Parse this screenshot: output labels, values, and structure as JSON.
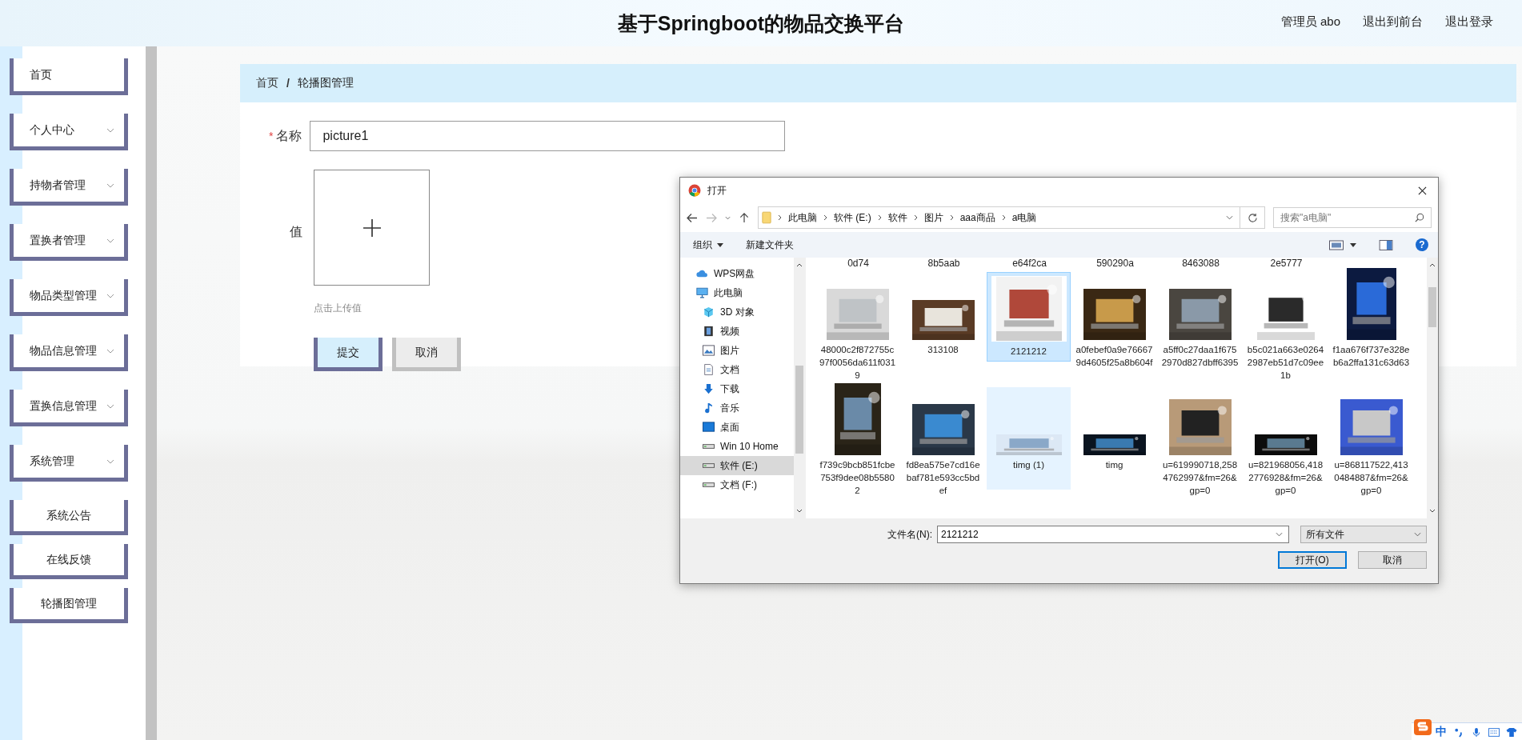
{
  "header": {
    "title": "基于Springboot的物品交换平台",
    "links": [
      "管理员 abo",
      "退出到前台",
      "退出登录"
    ]
  },
  "sidebar": {
    "items": [
      {
        "label": "首页",
        "submenu": false
      },
      {
        "label": "个人中心",
        "submenu": true
      },
      {
        "label": "持物者管理",
        "submenu": true
      },
      {
        "label": "置换者管理",
        "submenu": true
      },
      {
        "label": "物品类型管理",
        "submenu": true
      },
      {
        "label": "物品信息管理",
        "submenu": true
      },
      {
        "label": "置换信息管理",
        "submenu": true
      },
      {
        "label": "系统管理",
        "submenu": true,
        "children": [
          {
            "label": "系统公告"
          },
          {
            "label": "在线反馈"
          },
          {
            "label": "轮播图管理"
          }
        ]
      }
    ]
  },
  "breadcrumb": {
    "items": [
      "首页",
      "轮播图管理"
    ],
    "separator": "/"
  },
  "form": {
    "name_label": "名称",
    "required_mark": "*",
    "name_value": "picture1",
    "value_label": "值",
    "upload_hint": "点击上传值",
    "submit": "提交",
    "cancel": "取消"
  },
  "dialog": {
    "title": "打开",
    "path": [
      "此电脑",
      "软件 (E:)",
      "软件",
      "图片",
      "aaa商品",
      "a电脑"
    ],
    "search_placeholder": "搜索\"a电脑\"",
    "toolbar": [
      "组织",
      "新建文件夹"
    ],
    "help_label": "?",
    "nav": [
      {
        "label": "WPS网盘",
        "selected": false
      },
      {
        "label": "此电脑",
        "selected": false,
        "children": [
          {
            "label": "3D 对象",
            "selected": false
          },
          {
            "label": "视频",
            "selected": false
          },
          {
            "label": "图片",
            "selected": false
          },
          {
            "label": "文档",
            "selected": false
          },
          {
            "label": "下载",
            "selected": false
          },
          {
            "label": "音乐",
            "selected": false
          },
          {
            "label": "桌面",
            "selected": false
          },
          {
            "label": "Win 10 Home",
            "selected": false
          },
          {
            "label": "软件 (E:)",
            "selected": true
          },
          {
            "label": "文档 (F:)",
            "selected": false
          }
        ]
      }
    ],
    "files_above": [
      "0d74",
      "8b5aab",
      "e64f2ca",
      "590290a",
      "8463088",
      "2e5777"
    ],
    "files": [
      {
        "name": "48000c2f872755c97f0056da611f0319",
        "selected": false,
        "hovered": false
      },
      {
        "name": "313108",
        "selected": false,
        "hovered": false
      },
      {
        "name": "2121212",
        "selected": true,
        "hovered": false
      },
      {
        "name": "a0febef0a9e766679d4605f25a8b604f",
        "selected": false,
        "hovered": false
      },
      {
        "name": "a5ff0c27daa1f6752970d827dbff6395",
        "selected": false,
        "hovered": false
      },
      {
        "name": "b5c021a663e02642987eb51d7c09ee1b",
        "selected": false,
        "hovered": false
      },
      {
        "name": "f1aa676f737e328eb6a2ffa131c63d63",
        "selected": false,
        "hovered": false
      },
      {
        "name": "f739c9bcb851fcbe753f9dee08b55802",
        "selected": false,
        "hovered": false
      },
      {
        "name": "fd8ea575e7cd16ebaf781e593cc5bdef",
        "selected": false,
        "hovered": false
      },
      {
        "name": "timg (1)",
        "selected": false,
        "hovered": true
      },
      {
        "name": "timg",
        "selected": false,
        "hovered": false
      },
      {
        "name": "u=619990718,2584762997&fm=26&gp=0",
        "selected": false,
        "hovered": false
      },
      {
        "name": "u=821968056,4182776928&fm=26&gp=0",
        "selected": false,
        "hovered": false
      },
      {
        "name": "u=868117522,4130484887&fm=26&gp=0",
        "selected": false,
        "hovered": false
      }
    ],
    "filename_label": "文件名(N):",
    "filename_value": "2121212",
    "filetype": "所有文件",
    "open_button": "打开(O)",
    "cancel_button": "取消"
  },
  "ime_bar": {
    "mode": "中"
  }
}
